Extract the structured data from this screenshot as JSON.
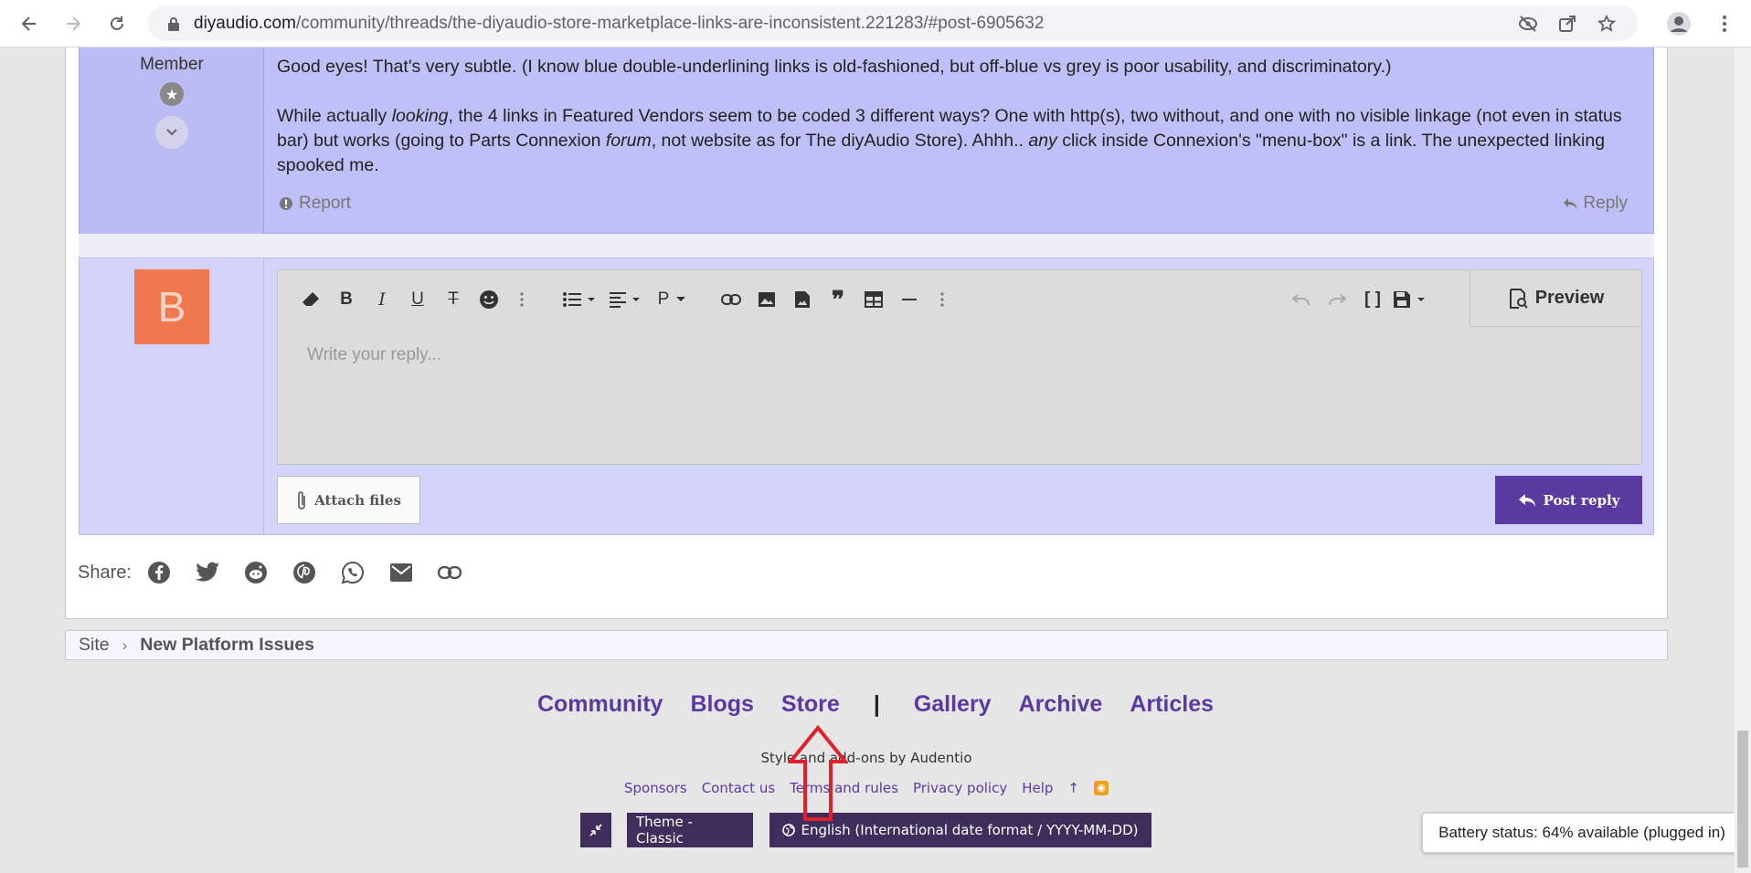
{
  "browser": {
    "url_host": "diyaudio.com",
    "url_path": "/community/threads/the-diyaudio-store-marketplace-links-are-inconsistent.221283/#post-6905632"
  },
  "post": {
    "role": "Member",
    "para1": "Good eyes! That's very subtle. (I know blue double-underlining links is old-fashioned, but off-blue vs grey is poor usability, and discriminatory.)",
    "para2_a": "While actually ",
    "para2_em1": "looking",
    "para2_b": ", the 4 links in Featured Vendors seem to be coded 3 different ways? One with http(s), two without, and one with no visible linkage (not even in status bar) but works (going to Parts Connexion ",
    "para2_em2": "forum",
    "para2_c": ", not website as for The diyAudio Store). Ahhh.. ",
    "para2_em3": "any",
    "para2_d": " click inside Connexion's \"menu-box\" is a link. The unexpected linking spooked me.",
    "report_label": "Report",
    "reply_label": "Reply"
  },
  "reply_box": {
    "avatar_letter": "B",
    "placeholder": "Write your reply...",
    "preview_label": "Preview",
    "attach_label": "Attach files",
    "post_reply_label": "Post reply",
    "paragraph_label": "P"
  },
  "share": {
    "label": "Share:",
    "icons": [
      "facebook-icon",
      "twitter-icon",
      "reddit-icon",
      "pinterest-icon",
      "whatsapp-icon",
      "email-icon",
      "link-icon"
    ]
  },
  "breadcrumb": {
    "root": "Site",
    "current": "New Platform Issues"
  },
  "footer": {
    "nav": [
      "Community",
      "Blogs",
      "Store",
      "Gallery",
      "Archive",
      "Articles"
    ],
    "separator": "|",
    "credit": "Style and add-ons by Audentio",
    "links": [
      "Sponsors",
      "Contact us",
      "Terms and rules",
      "Privacy policy",
      "Help"
    ],
    "theme_label": "Theme - Classic",
    "language_label": "English (International date format / YYYY-MM-DD)"
  },
  "notification": {
    "battery": "Battery status: 64% available (plugged in)"
  },
  "colors": {
    "accent": "#5b3aa0",
    "post_bg": "#c0c0f8",
    "reply_bg": "#d4d4fa",
    "avatar_bg": "#f07850",
    "annotation_red": "#e0202a"
  }
}
